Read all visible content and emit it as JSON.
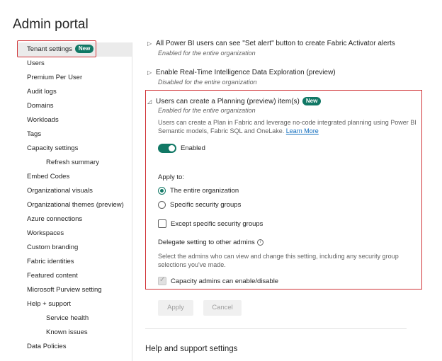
{
  "page": {
    "title": "Admin portal"
  },
  "sidebar": {
    "items": [
      {
        "label": "Tenant settings",
        "badge": "New"
      },
      {
        "label": "Users"
      },
      {
        "label": "Premium Per User"
      },
      {
        "label": "Audit logs"
      },
      {
        "label": "Domains"
      },
      {
        "label": "Workloads"
      },
      {
        "label": "Tags"
      },
      {
        "label": "Capacity settings"
      },
      {
        "label": "Refresh summary"
      },
      {
        "label": "Embed Codes"
      },
      {
        "label": "Organizational visuals"
      },
      {
        "label": "Organizational themes (preview)"
      },
      {
        "label": "Azure connections"
      },
      {
        "label": "Workspaces"
      },
      {
        "label": "Custom branding"
      },
      {
        "label": "Fabric identities"
      },
      {
        "label": "Featured content"
      },
      {
        "label": "Microsoft Purview setting"
      },
      {
        "label": "Help + support"
      },
      {
        "label": "Service health"
      },
      {
        "label": "Known issues"
      },
      {
        "label": "Data Policies"
      }
    ]
  },
  "settings": {
    "alerts": {
      "title": "All Power BI users can see \"Set alert\" button to create Fabric Activator alerts",
      "status": "Enabled for the entire organization"
    },
    "rti": {
      "title": "Enable Real-Time Intelligence Data Exploration (preview)",
      "status": "Disabled for the entire organization"
    },
    "planning": {
      "title": "Users can create a Planning (preview) item(s)",
      "badge": "New",
      "status": "Enabled for the entire organization",
      "description": "Users can create a Plan in Fabric and leverage no-code integrated planning using Power BI Semantic models, Fabric SQL and OneLake.",
      "learn_more": "Learn More",
      "toggle_label": "Enabled",
      "apply_to_label": "Apply to:",
      "radio_entire": "The entire organization",
      "radio_specific": "Specific security groups",
      "except_label": "Except specific security groups",
      "delegate_title": "Delegate setting to other admins",
      "delegate_desc": "Select the admins who can view and change this setting, including any security group selections you've made.",
      "capacity_admins_label": "Capacity admins can enable/disable",
      "apply_button": "Apply",
      "cancel_button": "Cancel"
    }
  },
  "help_section": {
    "title": "Help and support settings"
  }
}
